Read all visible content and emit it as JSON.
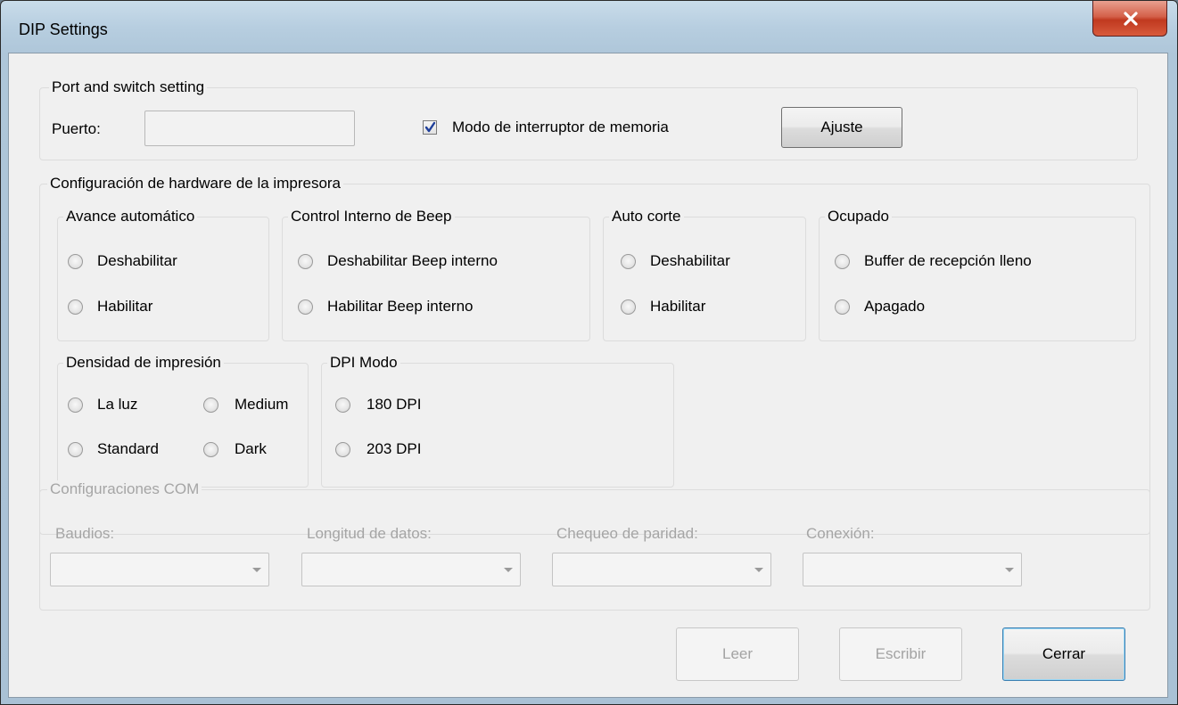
{
  "window": {
    "title": "DIP Settings"
  },
  "port_group": {
    "legend": "Port and switch setting",
    "port_label": "Puerto:",
    "port_value": "",
    "memory_switch_label": "Modo de interruptor de memoria",
    "memory_switch_checked": true,
    "adjust_button": "Ajuste"
  },
  "hardware_group": {
    "legend": "Configuración de hardware de la impresora",
    "auto_feed": {
      "legend": "Avance automático",
      "options": [
        "Deshabilitar",
        "Habilitar"
      ]
    },
    "beep_control": {
      "legend": "Control Interno de Beep",
      "options": [
        "Deshabilitar Beep interno",
        "Habilitar Beep interno"
      ]
    },
    "auto_cut": {
      "legend": "Auto corte",
      "options": [
        "Deshabilitar",
        "Habilitar"
      ]
    },
    "busy": {
      "legend": "Ocupado",
      "options": [
        "Buffer de recepción lleno",
        "Apagado"
      ]
    },
    "print_density": {
      "legend": "Densidad de impresión",
      "options": [
        "La luz",
        "Medium",
        "Standard",
        "Dark"
      ]
    },
    "dpi_mode": {
      "legend": "DPI Modo",
      "options": [
        "180 DPI",
        "203 DPI"
      ]
    }
  },
  "com_group": {
    "legend": "Configuraciones COM",
    "fields": [
      {
        "label": "Baudios:",
        "value": ""
      },
      {
        "label": "Longitud de datos:",
        "value": ""
      },
      {
        "label": "Chequeo de paridad:",
        "value": ""
      },
      {
        "label": "Conexión:",
        "value": ""
      }
    ]
  },
  "buttons": {
    "read": "Leer",
    "write": "Escribir",
    "close": "Cerrar"
  }
}
